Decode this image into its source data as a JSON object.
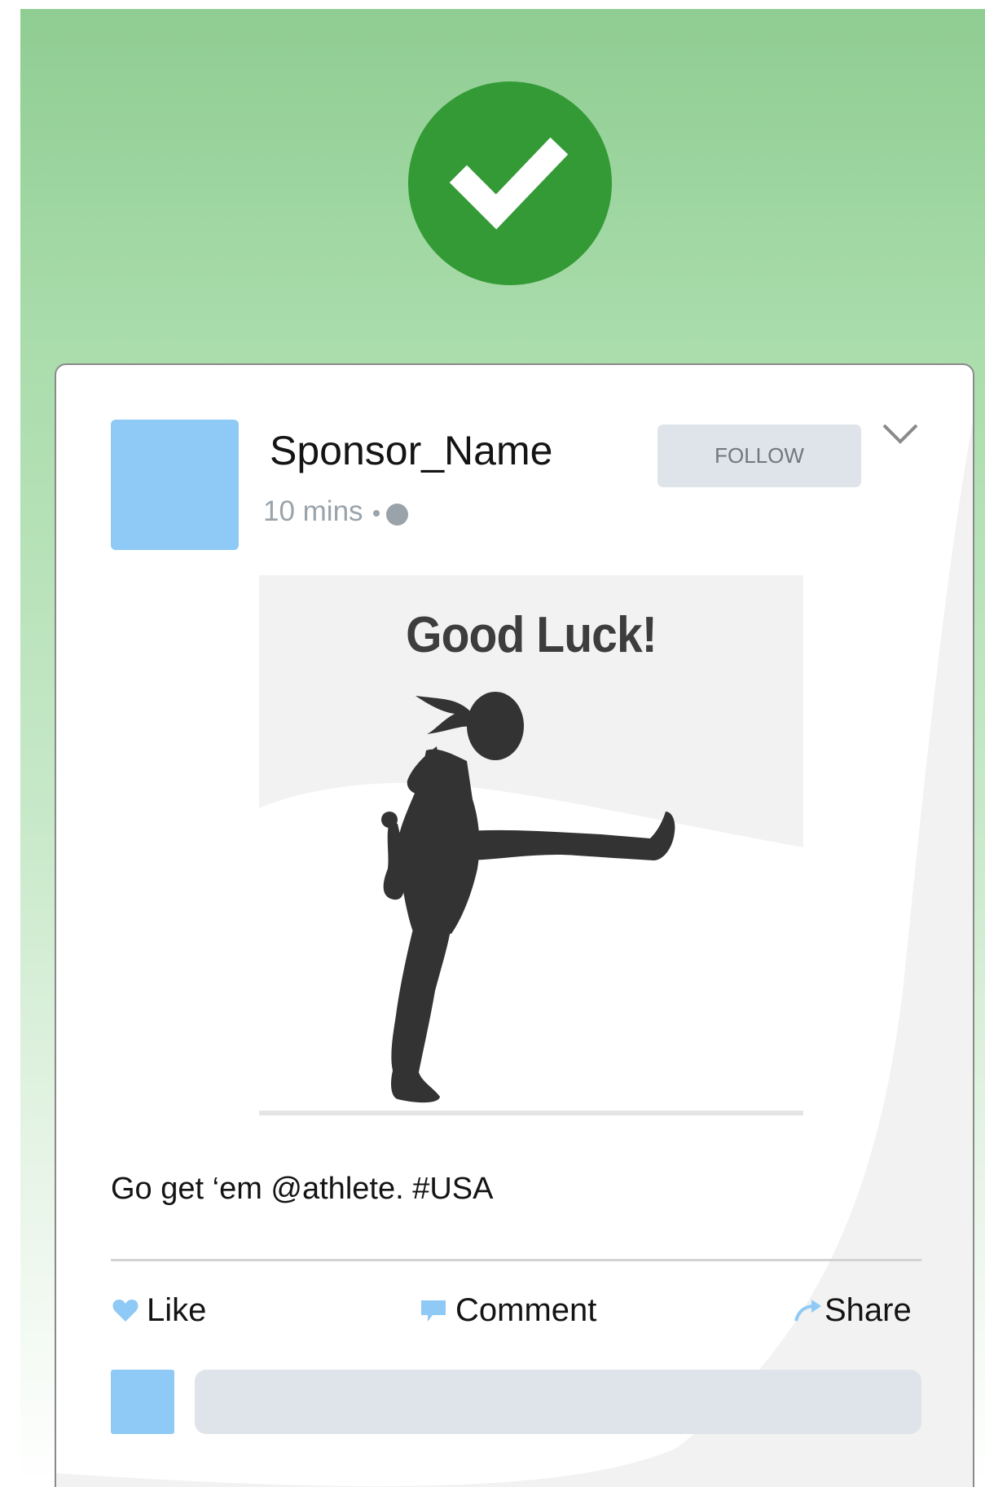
{
  "status": {
    "icon": "checkmark-icon",
    "color": "#349a36"
  },
  "post": {
    "sponsor_name": "Sponsor_Name",
    "time": "10 mins",
    "privacy_icon": "globe-icon",
    "follow_label": "FOLLOW",
    "menu_icon": "chevron-down-icon",
    "image_title": "Good Luck!",
    "caption": "Go get ‘em @athlete. #USA",
    "actions": {
      "like_label": "Like",
      "comment_label": "Comment",
      "share_label": "Share"
    },
    "comment_placeholder": ""
  },
  "colors": {
    "accent": "#8ecaf5",
    "background_top": "#8fcd92",
    "follow_bg": "#dfe4ea",
    "silhouette": "#333333"
  }
}
